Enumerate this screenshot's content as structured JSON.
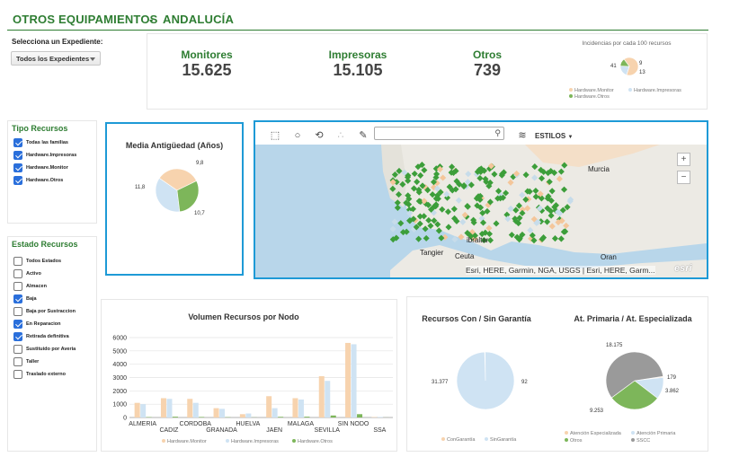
{
  "header": {
    "title_left": "OTROS EQUIPAMIENTOS",
    "separator": "-",
    "title_right": "ANDALUCÍA"
  },
  "filter": {
    "label": "Selecciona un Expediente:",
    "selected": "Todos los Expedientes"
  },
  "kpis": [
    {
      "label": "Monitores",
      "value": "15.625"
    },
    {
      "label": "Impresoras",
      "value": "15.105"
    },
    {
      "label": "Otros",
      "value": "739"
    }
  ],
  "incidencias": {
    "title": "Incidencias por cada 100 recursos",
    "chart_data": {
      "type": "pie",
      "labels": [
        "Hardware.Monitor",
        "Hardware.Impresoras",
        "Hardware.Otros"
      ],
      "values": [
        41,
        13,
        9
      ],
      "data_labels": [
        "41",
        "13",
        "9"
      ],
      "colors": [
        "#f7d3ae",
        "#cfe3f3",
        "#7db65a"
      ],
      "legend_position": "bottom"
    },
    "legend": [
      "Hardware.Monitor",
      "Hardware.Impresoras",
      "Hardware.Otros"
    ]
  },
  "tipo_recursos": {
    "title": "Tipo Recursos",
    "items": [
      {
        "label": "Todas las familias",
        "checked": true
      },
      {
        "label": "Hardware.Impresoras",
        "checked": true
      },
      {
        "label": "Hardware.Monitor",
        "checked": true
      },
      {
        "label": "Hardware.Otros",
        "checked": true
      }
    ]
  },
  "estado_recursos": {
    "title": "Estado Recursos",
    "items": [
      {
        "label": "Todos Estados",
        "checked": false
      },
      {
        "label": "Activo",
        "checked": false
      },
      {
        "label": "Almacen",
        "checked": false
      },
      {
        "label": "Baja",
        "checked": true
      },
      {
        "label": "Baja por Sustraccion",
        "checked": false
      },
      {
        "label": "En Reparacion",
        "checked": true
      },
      {
        "label": "Retirada definitiva",
        "checked": true
      },
      {
        "label": "Sustituido por Averia",
        "checked": false
      },
      {
        "label": "Taller",
        "checked": false
      },
      {
        "label": "Traslado externo",
        "checked": false
      }
    ]
  },
  "antiguedad": {
    "title": "Media Antigüedad (Años)",
    "chart_data": {
      "type": "pie",
      "values": [
        11.8,
        10.7,
        9.8
      ],
      "data_labels": [
        "11,8",
        "10,7",
        "9,8"
      ],
      "colors": [
        "#cfe3f3",
        "#f7d3ae",
        "#7db65a"
      ]
    }
  },
  "map": {
    "styles_label": "ESTILOS",
    "search_placeholder": "",
    "attribution": "Esri, HERE, Garmin, NGA, USGS | Esri, HERE, Garm...",
    "logo": "esri",
    "labels": {
      "murcia": "Murcia",
      "gibraltar": "ibraltar",
      "tangier": "Tangier",
      "ceuta": "Ceuta",
      "oran": "Oran"
    },
    "zoom_in": "+",
    "zoom_out": "−"
  },
  "volumen": {
    "title": "Volumen Recursos por Nodo",
    "chart_data": {
      "type": "bar",
      "categories": [
        "ALMERIA",
        "CADIZ",
        "CORDOBA",
        "GRANADA",
        "HUELVA",
        "JAEN",
        "MALAGA",
        "SEVILLA",
        "SIN NODO",
        "SSA"
      ],
      "series": [
        {
          "name": "Hardware.Monitor",
          "color": "#f7d3ae",
          "values": [
            1100,
            1450,
            1400,
            700,
            250,
            1600,
            1450,
            3100,
            5600,
            30
          ]
        },
        {
          "name": "Hardware.Impresoras",
          "color": "#cfe3f3",
          "values": [
            1000,
            1400,
            1100,
            650,
            300,
            700,
            1350,
            2750,
            5500,
            40
          ]
        },
        {
          "name": "Hardware.Otros",
          "color": "#7db65a",
          "values": [
            30,
            60,
            40,
            20,
            10,
            50,
            60,
            150,
            250,
            5
          ]
        }
      ],
      "ylim": [
        0,
        6000
      ],
      "yticks": [
        "0",
        "1000",
        "2000",
        "3000",
        "4000",
        "5000",
        "6000"
      ],
      "grid": true,
      "legend_position": "bottom"
    }
  },
  "garantia": {
    "title": "Recursos Con / Sin Garantía",
    "chart_data": {
      "type": "pie",
      "labels": [
        "ConGarantía",
        "SinGarantía"
      ],
      "values": [
        92,
        31377
      ],
      "data_labels": [
        "92",
        "31.377"
      ],
      "colors": [
        "#f7d3ae",
        "#cfe3f3"
      ],
      "legend_position": "bottom"
    },
    "legend": [
      "ConGarantía",
      "SinGarantía"
    ]
  },
  "atencion": {
    "title": "At. Primaria / At. Especializada",
    "chart_data": {
      "type": "pie",
      "labels": [
        "Atención Especializada",
        "Atención Primaria",
        "Otros",
        "SSCC"
      ],
      "values": [
        179,
        3862,
        9253,
        18175
      ],
      "data_labels": [
        "179",
        "3.862",
        "9.253",
        "18.175"
      ],
      "colors": [
        "#f7d3ae",
        "#cfe3f3",
        "#7db65a",
        "#9a9a9a"
      ],
      "legend_position": "bottom"
    },
    "legend": [
      "Atención Especializada",
      "Atención Primaria",
      "Otros",
      "SSCC"
    ]
  }
}
